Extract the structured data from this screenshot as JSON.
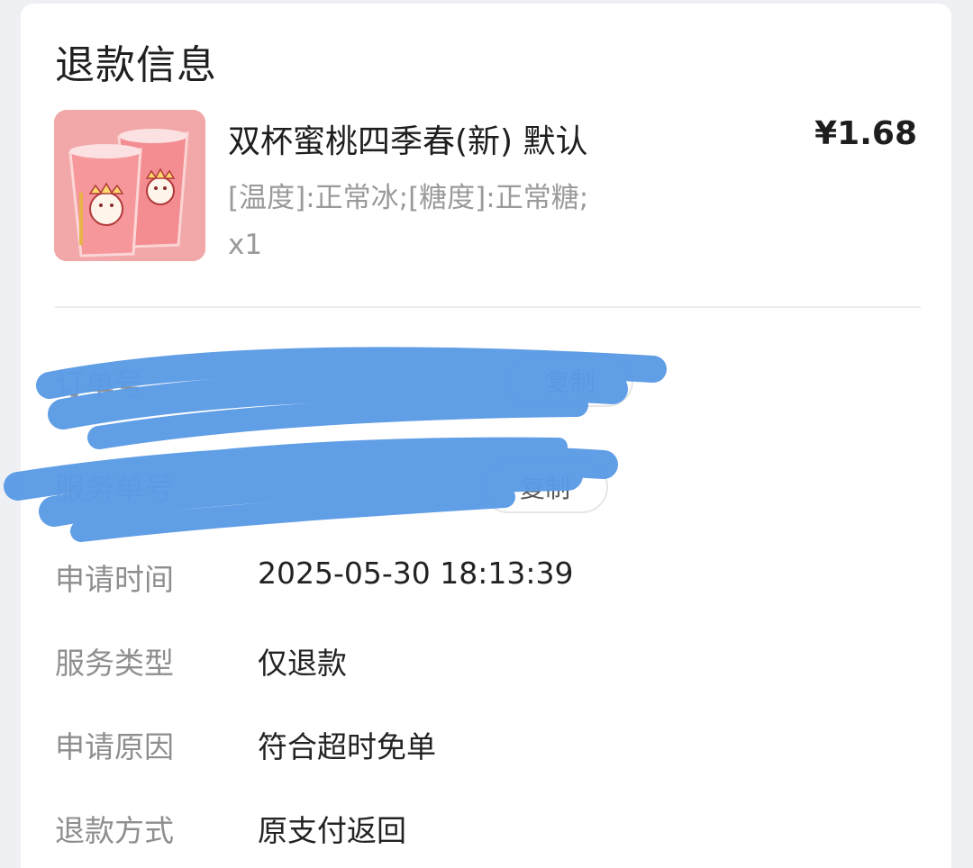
{
  "header": {
    "title": "退款信息"
  },
  "product": {
    "name": "双杯蜜桃四季春(新) 默认",
    "spec": "[温度]:正常冰;[糖度]:正常糖;",
    "qty": "x1",
    "price": "¥1.68"
  },
  "redacted_rows": [
    {
      "label": "订单号",
      "copy": "复制"
    },
    {
      "label": "服务单号",
      "copy": "复制"
    }
  ],
  "details": [
    {
      "label": "申请时间",
      "value": "2025-05-30 18:13:39"
    },
    {
      "label": "服务类型",
      "value": "仅退款"
    },
    {
      "label": "申请原因",
      "value": "符合超时免单"
    },
    {
      "label": "退款方式",
      "value": "原支付返回"
    }
  ],
  "colors": {
    "redaction": "#5b9be6",
    "card": "#ffffff",
    "page": "#eef0f3"
  }
}
